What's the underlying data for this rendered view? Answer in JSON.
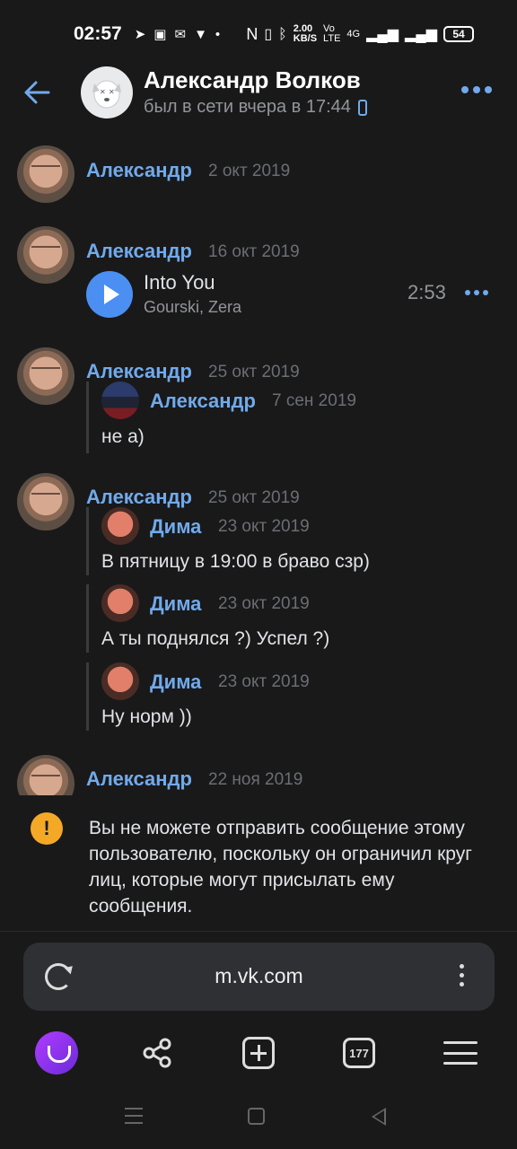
{
  "status": {
    "time": "02:57",
    "network_speed": "2.00\nKB/S",
    "volte": "Vo\nLTE",
    "lte": "4G",
    "battery": "54"
  },
  "header": {
    "name": "Александр Волков",
    "status": "был в сети вчера в 17:44"
  },
  "messages": [
    {
      "author": "Александр",
      "date": "2 окт 2019"
    },
    {
      "author": "Александр",
      "date": "16 окт 2019",
      "audio": {
        "title": "Into You",
        "artist": "Gourski, Zera",
        "duration": "2:53"
      }
    },
    {
      "author": "Александр",
      "date": "25 окт 2019",
      "quotes": [
        {
          "author": "Александр",
          "date": "7 сен 2019",
          "text": "не а)"
        }
      ]
    },
    {
      "author": "Александр",
      "date": "25 окт 2019",
      "quotes": [
        {
          "author": "Дима",
          "date": "23 окт 2019",
          "text": "В пятницу в 19:00 в браво сзр)"
        },
        {
          "author": "Дима",
          "date": "23 окт 2019",
          "text": "А ты поднялся ?) Успел ?)"
        },
        {
          "author": "Дима",
          "date": "23 окт 2019",
          "text": "Ну норм ))"
        }
      ]
    },
    {
      "author": "Александр",
      "date": "22 ноя 2019"
    }
  ],
  "notice": {
    "text": "Вы не можете отправить сообщение этому пользователю, поскольку он ограничил круг лиц, которые могут присылать ему сообщения.",
    "icon": "!"
  },
  "browser": {
    "url": "m.vk.com",
    "tabs_count": "177"
  }
}
